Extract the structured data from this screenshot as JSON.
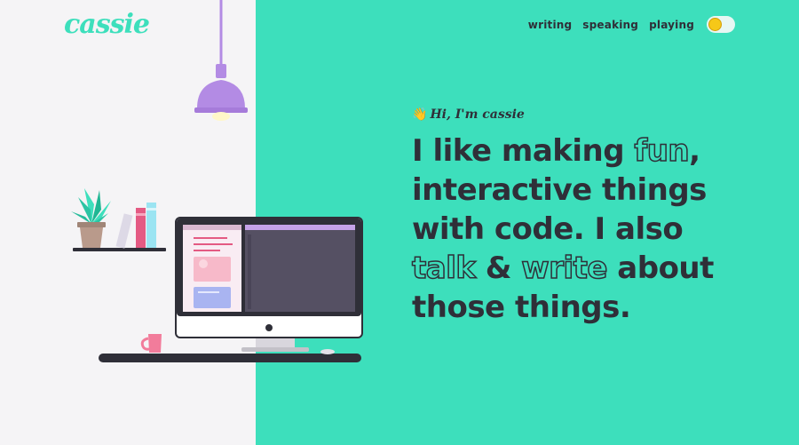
{
  "logo": {
    "text": "cassie"
  },
  "nav": {
    "links": [
      "writing",
      "speaking",
      "playing"
    ],
    "toggle_label": "theme toggle"
  },
  "hero": {
    "greeting_emoji": "👋",
    "greeting": "Hi, I'm cassie",
    "line1_start": "I like making ",
    "line1_outline": "fun",
    "line1_end": ",",
    "line2": "interactive things",
    "line3": "with code. I also",
    "line4_outline1": "talk",
    "line4_mid": " & ",
    "line4_outline2": "write",
    "line4_end": " about",
    "line5": "those things."
  },
  "colors": {
    "accent": "#3ddfbc",
    "text": "#2f2f38",
    "lamp": "#b38be4",
    "background": "#f5f4f6"
  }
}
